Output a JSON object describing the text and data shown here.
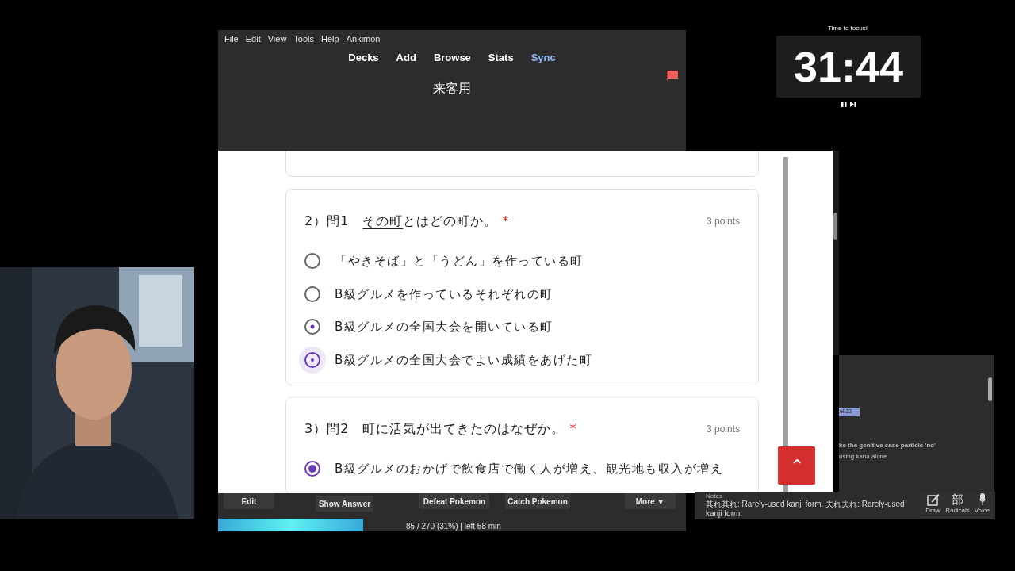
{
  "menu": [
    "File",
    "Edit",
    "View",
    "Tools",
    "Help",
    "Ankimon"
  ],
  "nav": [
    {
      "label": "Decks",
      "selected": false
    },
    {
      "label": "Add",
      "selected": false
    },
    {
      "label": "Browse",
      "selected": false
    },
    {
      "label": "Stats",
      "selected": false
    },
    {
      "label": "Sync",
      "selected": true
    }
  ],
  "deck_title": "来客用",
  "flagged": true,
  "questions": [
    {
      "number": "2）問1　",
      "underlined": "その町",
      "title": "とはどの町か。",
      "required": "*",
      "points": "3 points",
      "options": [
        {
          "label": "「やきそば」と「うどん」を作っている町",
          "selected": false,
          "fading": false,
          "hovered": false
        },
        {
          "label": "B級グルメを作っているそれぞれの町",
          "selected": false,
          "fading": false,
          "hovered": false
        },
        {
          "label": "B級グルメの全国大会を開いている町",
          "selected": false,
          "fading": true,
          "hovered": false
        },
        {
          "label": "B級グルメの全国大会でよい成績をあげた町",
          "selected": true,
          "fading": false,
          "hovered": true
        }
      ]
    },
    {
      "number": "3）問2　",
      "title": "町に活気が出てきたのはなぜか。",
      "required": "*",
      "points": "3 points",
      "options": [
        {
          "label": "B級グルメのおかげで飲食店で働く人が増え、観光地も収入が増え",
          "selected": true,
          "fading": false,
          "hovered": false
        }
      ]
    }
  ],
  "scroll_top_button": "⌃",
  "bottom_buttons": [
    "Edit",
    "Show Answer",
    "Defeat Pokemon",
    "Catch Pokemon",
    "More ▼"
  ],
  "progress": {
    "level": 0.31,
    "text": "85 / 270 (31%) | left 58 min"
  },
  "timer": {
    "caption": "Time to focus!",
    "time": "31:44"
  },
  "side_panel": {
    "tag": "el.22",
    "lines": [
      "ke the genitive case particle 'no'",
      "using kana alone"
    ],
    "notes_label": "Notes",
    "notes": "其れ其れ: Rarely-used kanji form. 夫れ夫れ: Rarely-used kanji form.",
    "tools": [
      {
        "kind": "draw",
        "label": "Draw"
      },
      {
        "kind": "radicals",
        "label": "Radicals",
        "glyph": "部"
      },
      {
        "kind": "voice",
        "label": "Voice"
      }
    ]
  }
}
